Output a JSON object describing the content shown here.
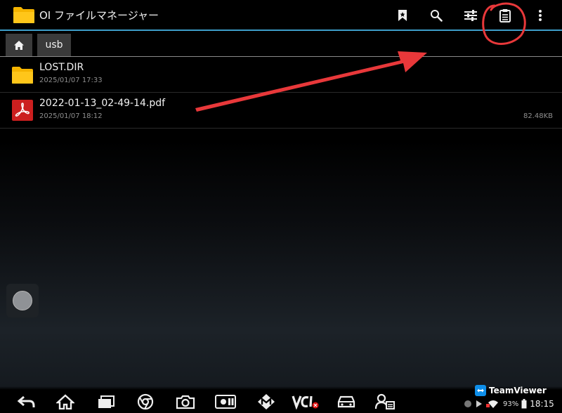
{
  "app": {
    "title": "OI ファイルマネージャー"
  },
  "toolbar": {
    "actions": [
      "bookmark-icon",
      "search-icon",
      "filter-settings-icon",
      "clipboard-icon",
      "overflow-menu-icon"
    ]
  },
  "breadcrumb": {
    "path": "usb"
  },
  "files": [
    {
      "name": "LOST.DIR",
      "date": "2025/01/07 17:33",
      "size": "",
      "type": "folder"
    },
    {
      "name": "2022-01-13_02-49-14.pdf",
      "date": "2025/01/07 18:12",
      "size": "82.48KB",
      "type": "pdf"
    }
  ],
  "statusbar": {
    "teamviewer": "TeamViewer",
    "battery": "93%",
    "time": "18:15"
  },
  "navbar": {
    "buttons": [
      "back-icon",
      "home-icon",
      "recents-icon",
      "chrome-icon",
      "camera-icon",
      "brightness-icon",
      "m-app-icon",
      "vci-icon",
      "car-icon",
      "technician-icon"
    ]
  },
  "colors": {
    "accent": "#3d9ec9",
    "folder": "#f5b400",
    "pdf": "#cc1f1f",
    "annotation": "#e8383a"
  }
}
